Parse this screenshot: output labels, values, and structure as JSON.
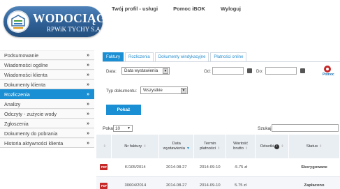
{
  "logo": {
    "title": "WODOCIĄGI",
    "subtitle": "RPWiK TYCHY S.A."
  },
  "topnav": [
    {
      "label": "Twój profil - usługi"
    },
    {
      "label": "Pomoc iBOK"
    },
    {
      "label": "Wyloguj"
    }
  ],
  "sidebar": {
    "arrow": "»",
    "items": [
      {
        "label": "Podsumowanie"
      },
      {
        "label": "Wiadomości ogólne"
      },
      {
        "label": "Wiadomości klienta"
      },
      {
        "label": "Dokumenty klienta"
      },
      {
        "label": "Rozliczenia"
      },
      {
        "label": "Analizy"
      },
      {
        "label": "Odczyty - zużycie wody"
      },
      {
        "label": "Zgłoszenia"
      },
      {
        "label": "Dokumenty do pobrania"
      },
      {
        "label": "Historia aktywności klienta"
      }
    ]
  },
  "tabs": [
    {
      "label": "Faktury"
    },
    {
      "label": "Rozliczenia"
    },
    {
      "label": "Dokumenty windykacyjne"
    },
    {
      "label": "Płatności online"
    }
  ],
  "filters": {
    "date_label": "Data:",
    "date_select": "Data wystawienia",
    "from_label": "Od:",
    "to_label": "Do:",
    "doc_type_label": "Typ dokumentu:",
    "doc_type_select": "Wszystkie",
    "show_button": "Pokaż",
    "help_label": "Pomoc"
  },
  "paging": {
    "show_label": "Pokaż",
    "page_size": "10",
    "search_label": "Szukaj:"
  },
  "table": {
    "headers": {
      "invoice_no": "Nr faktury",
      "issue_date_1": "Data",
      "issue_date_2": "wystawienia",
      "due_date_1": "Termin",
      "due_date_2": "płatności",
      "gross_1": "Wartość",
      "gross_2": "brutto",
      "interest": "Odsetki",
      "status": "Status"
    },
    "pdf_icon_text": "PDF",
    "rows": [
      {
        "invoice_no": "K/105/2014",
        "issue_date": "2014-08-27",
        "due_date": "2014-09-10",
        "gross": "-5.75 zł",
        "interest": "",
        "status": "Skorygowane"
      },
      {
        "invoice_no": "30604/2014",
        "issue_date": "2014-08-27",
        "due_date": "2014-09-10",
        "gross": "5.75 zł",
        "interest": "",
        "status": "Zapłacono"
      }
    ]
  },
  "colors": {
    "accent": "#1a8fd4",
    "logo_blue": "#2e5f95",
    "pdf_red": "#c62828"
  }
}
